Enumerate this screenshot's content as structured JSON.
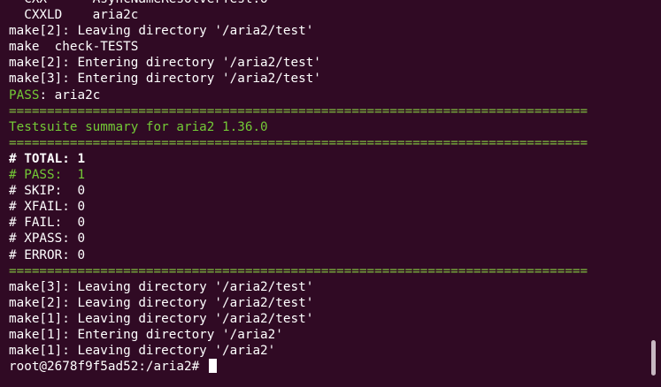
{
  "terminal": {
    "lines": [
      {
        "text": "  CXX      AsyncNameResolverTest.o",
        "style": "normal"
      },
      {
        "text": "  CXXLD    aria2c",
        "style": "normal"
      },
      {
        "text": "make[2]: Leaving directory '/aria2/test'",
        "style": "normal"
      },
      {
        "text": "make  check-TESTS",
        "style": "normal"
      },
      {
        "text": "make[2]: Entering directory '/aria2/test'",
        "style": "normal"
      },
      {
        "text": "make[3]: Entering directory '/aria2/test'",
        "style": "normal"
      },
      {
        "text": "PASS",
        "suffix": ": aria2c",
        "style": "pass"
      },
      {
        "text": "============================================================================",
        "style": "rule"
      },
      {
        "text": "Testsuite summary for aria2 1.36.0",
        "style": "summary"
      },
      {
        "text": "============================================================================",
        "style": "rule"
      },
      {
        "text": "# TOTAL: 1",
        "style": "bold"
      },
      {
        "text": "# PASS:  1",
        "style": "green"
      },
      {
        "text": "# SKIP:  0",
        "style": "normal"
      },
      {
        "text": "# XFAIL: 0",
        "style": "normal"
      },
      {
        "text": "# FAIL:  0",
        "style": "normal"
      },
      {
        "text": "# XPASS: 0",
        "style": "normal"
      },
      {
        "text": "# ERROR: 0",
        "style": "normal"
      },
      {
        "text": "============================================================================",
        "style": "rule"
      },
      {
        "text": "make[3]: Leaving directory '/aria2/test'",
        "style": "normal"
      },
      {
        "text": "make[2]: Leaving directory '/aria2/test'",
        "style": "normal"
      },
      {
        "text": "make[1]: Leaving directory '/aria2/test'",
        "style": "normal"
      },
      {
        "text": "make[1]: Entering directory '/aria2'",
        "style": "normal"
      },
      {
        "text": "make[1]: Leaving directory '/aria2'",
        "style": "normal"
      }
    ],
    "prompt": "root@2678f9f5ad52:/aria2# "
  },
  "colors": {
    "background": "#300a24",
    "green": "#8ae234",
    "rule": "#7fbf3f"
  }
}
